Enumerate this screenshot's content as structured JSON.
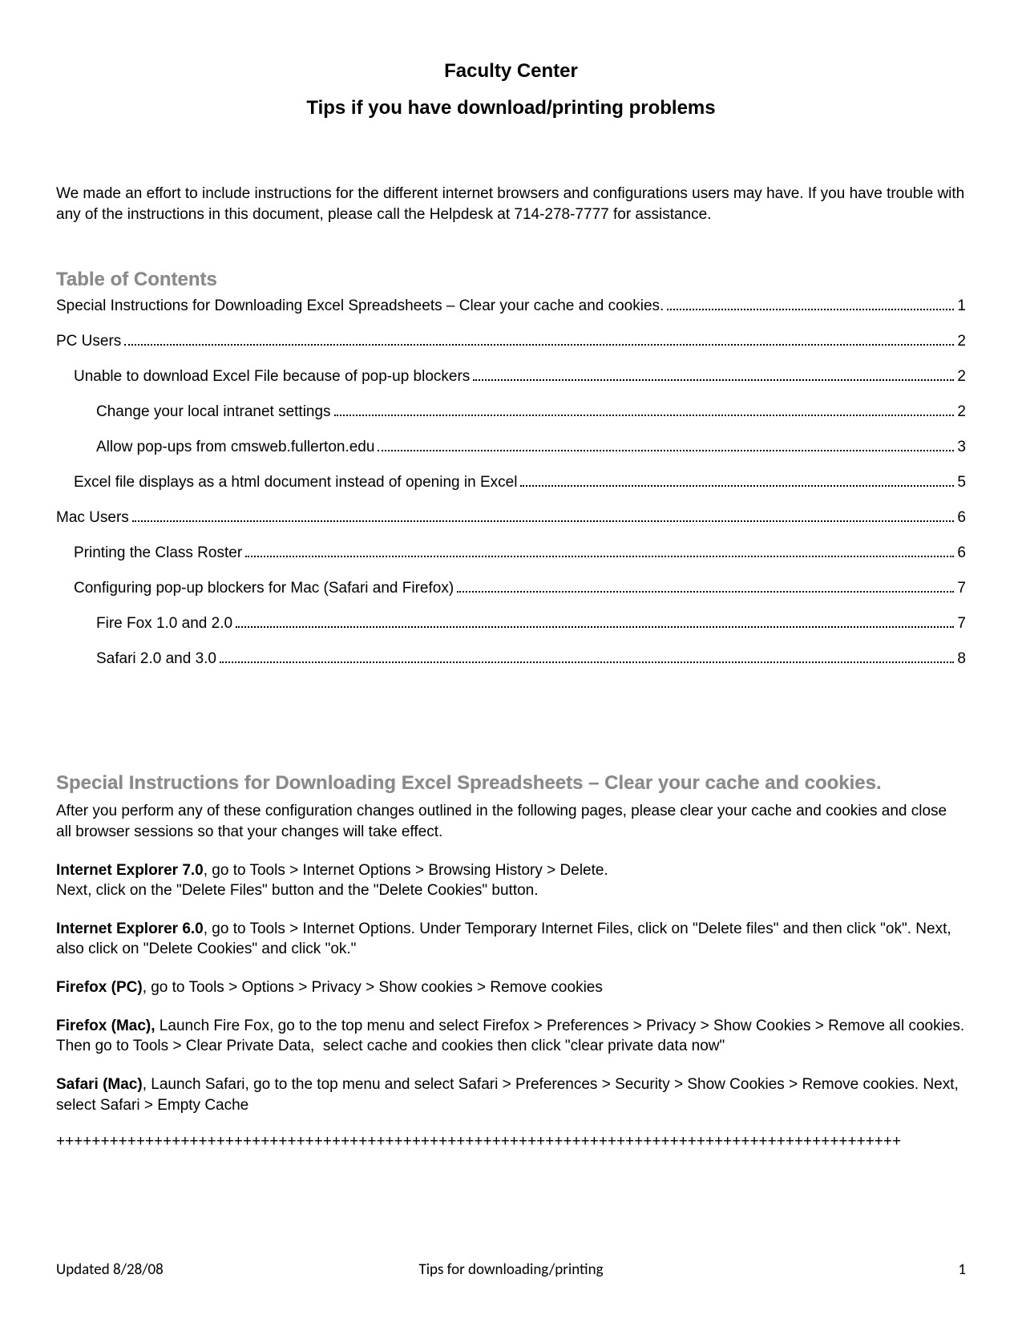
{
  "header": {
    "title": "Faculty Center",
    "subtitle": "Tips if you have download/printing problems"
  },
  "intro": "We made an effort to include instructions for the different internet browsers and configurations users may have. If you have trouble with any of the instructions in this document, please call the Helpdesk at 714-278-7777 for assistance.",
  "toc_heading": "Table of Contents",
  "toc": [
    {
      "level": 0,
      "label": "Special Instructions for Downloading Excel Spreadsheets – Clear your cache and cookies.",
      "page": "1"
    },
    {
      "level": 0,
      "label": "PC Users",
      "page": "2"
    },
    {
      "level": 1,
      "label": "Unable to download Excel File because of pop-up blockers",
      "page": "2"
    },
    {
      "level": 2,
      "label": "Change your local intranet settings",
      "page": "2"
    },
    {
      "level": 2,
      "label": "Allow pop-ups from cmsweb.fullerton.edu",
      "page": "3"
    },
    {
      "level": 1,
      "label": "Excel file displays as a html document instead of opening in Excel",
      "page": "5"
    },
    {
      "level": 0,
      "label": "Mac Users",
      "page": "6"
    },
    {
      "level": 1,
      "label": "Printing the Class Roster",
      "page": "6"
    },
    {
      "level": 1,
      "label": "Configuring pop-up blockers for Mac (Safari and Firefox)",
      "page": "7"
    },
    {
      "level": 2,
      "label": "Fire Fox 1.0 and 2.0",
      "page": "7"
    },
    {
      "level": 2,
      "label": "Safari 2.0 and 3.0",
      "page": "8"
    }
  ],
  "section1_heading": "Special Instructions for Downloading Excel Spreadsheets – Clear your cache and cookies.",
  "section1_intro": "After you perform any of these configuration changes outlined in the following pages, please clear your cache and cookies and close all browser sessions so that your changes will take effect.",
  "instructions": [
    {
      "bold": "Internet Explorer 7.0",
      "text": ", go to Tools > Internet Options > Browsing History > Delete.\nNext, click on the \"Delete Files\" button and the \"Delete Cookies\" button."
    },
    {
      "bold": "Internet Explorer 6.0",
      "text": ", go to Tools > Internet Options. Under Temporary Internet Files, click on \"Delete files\" and then click \"ok\". Next, also click on \"Delete Cookies\" and click \"ok.\""
    },
    {
      "bold": "Firefox (PC)",
      "text": ", go to Tools > Options > Privacy > Show cookies > Remove cookies"
    },
    {
      "bold": "Firefox (Mac),",
      "text": " Launch Fire Fox, go to the top menu and select Firefox > Preferences > Privacy > Show Cookies > Remove all cookies. Then go to Tools > Clear Private Data,  select cache and cookies then click \"clear private data now\""
    },
    {
      "bold": "Safari (Mac)",
      "text": ", Launch Safari, go to the top menu and select Safari > Preferences > Security > Show Cookies > Remove cookies. Next, select Safari > Empty Cache"
    }
  ],
  "divider": "+++++++++++++++++++++++++++++++++++++++++++++++++++++++++++++++++++++++++++++++++++++++++++++++",
  "footer": {
    "left": "Updated 8/28/08",
    "center": "Tips for downloading/printing",
    "right": "1"
  }
}
